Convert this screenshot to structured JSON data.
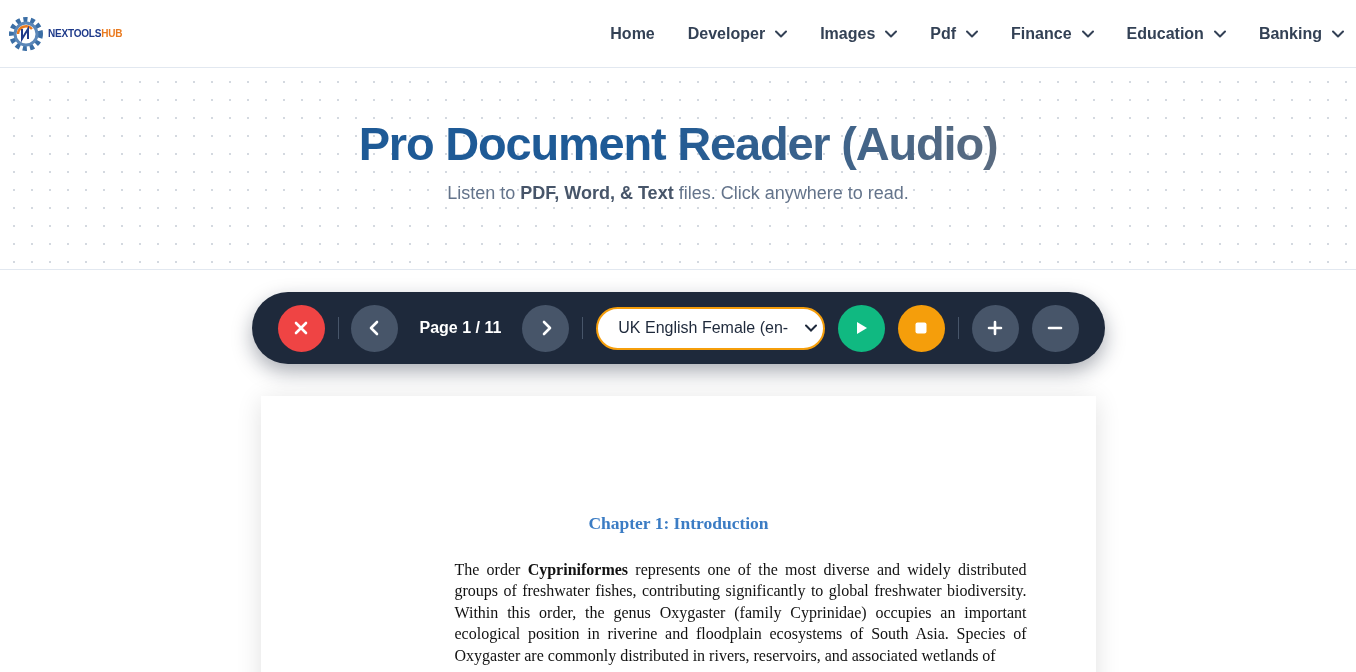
{
  "logo": {
    "text_main": "NEXTOOLS",
    "text_accent": "HUB"
  },
  "nav": [
    {
      "label": "Home",
      "has_menu": false
    },
    {
      "label": "Developer",
      "has_menu": true
    },
    {
      "label": "Images",
      "has_menu": true
    },
    {
      "label": "Pdf",
      "has_menu": true
    },
    {
      "label": "Finance",
      "has_menu": true
    },
    {
      "label": "Education",
      "has_menu": true
    },
    {
      "label": "Banking",
      "has_menu": true
    }
  ],
  "hero": {
    "title": "Pro Document Reader (Audio)",
    "subtitle": "Listen to **PDF, Word, & Text** files. Click anywhere to read."
  },
  "toolbar": {
    "page_label": "Page 1 / 11",
    "voice": "UK English Female (en-"
  },
  "document": {
    "heading": "Chapter 1: Introduction",
    "paragraph": "The order **Cypriniformes** represents one of the most diverse and widely distributed groups of freshwater fishes, contributing significantly to global freshwater biodiversity. Within this order, the genus Oxygaster (family Cyprinidae) occupies an important ecological position in riverine and floodplain ecosystems of South Asia. Species of Oxygaster are commonly distributed in rivers, reservoirs, and associated wetlands of"
  }
}
